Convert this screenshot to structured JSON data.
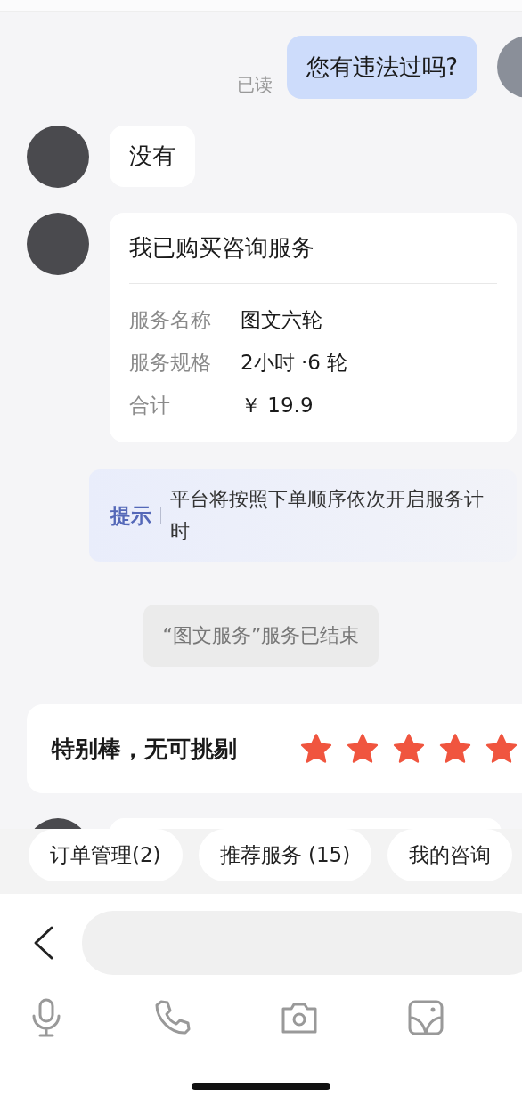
{
  "messages": [
    {
      "kind": "outgoing",
      "text": "您有违法过吗?",
      "status": "已读"
    },
    {
      "kind": "incoming",
      "text": "没有"
    },
    {
      "kind": "order",
      "title": "我已购买咨询服务",
      "rows": [
        {
          "label": "服务名称",
          "value": "图文六轮"
        },
        {
          "label": "服务规格",
          "value": "2小时 ·6 轮"
        },
        {
          "label": "合计",
          "value": "￥ 19.9"
        }
      ]
    }
  ],
  "tip": {
    "label": "提示",
    "text": "平台将按照下单顺序依次开启服务计时"
  },
  "notice": "“图文服务”服务已结束",
  "rating": {
    "text": "特别棒，无可挑剔",
    "stars": 5
  },
  "quick_actions": [
    "订单管理(2)",
    "推荐服务 (15)",
    "我的咨询"
  ]
}
